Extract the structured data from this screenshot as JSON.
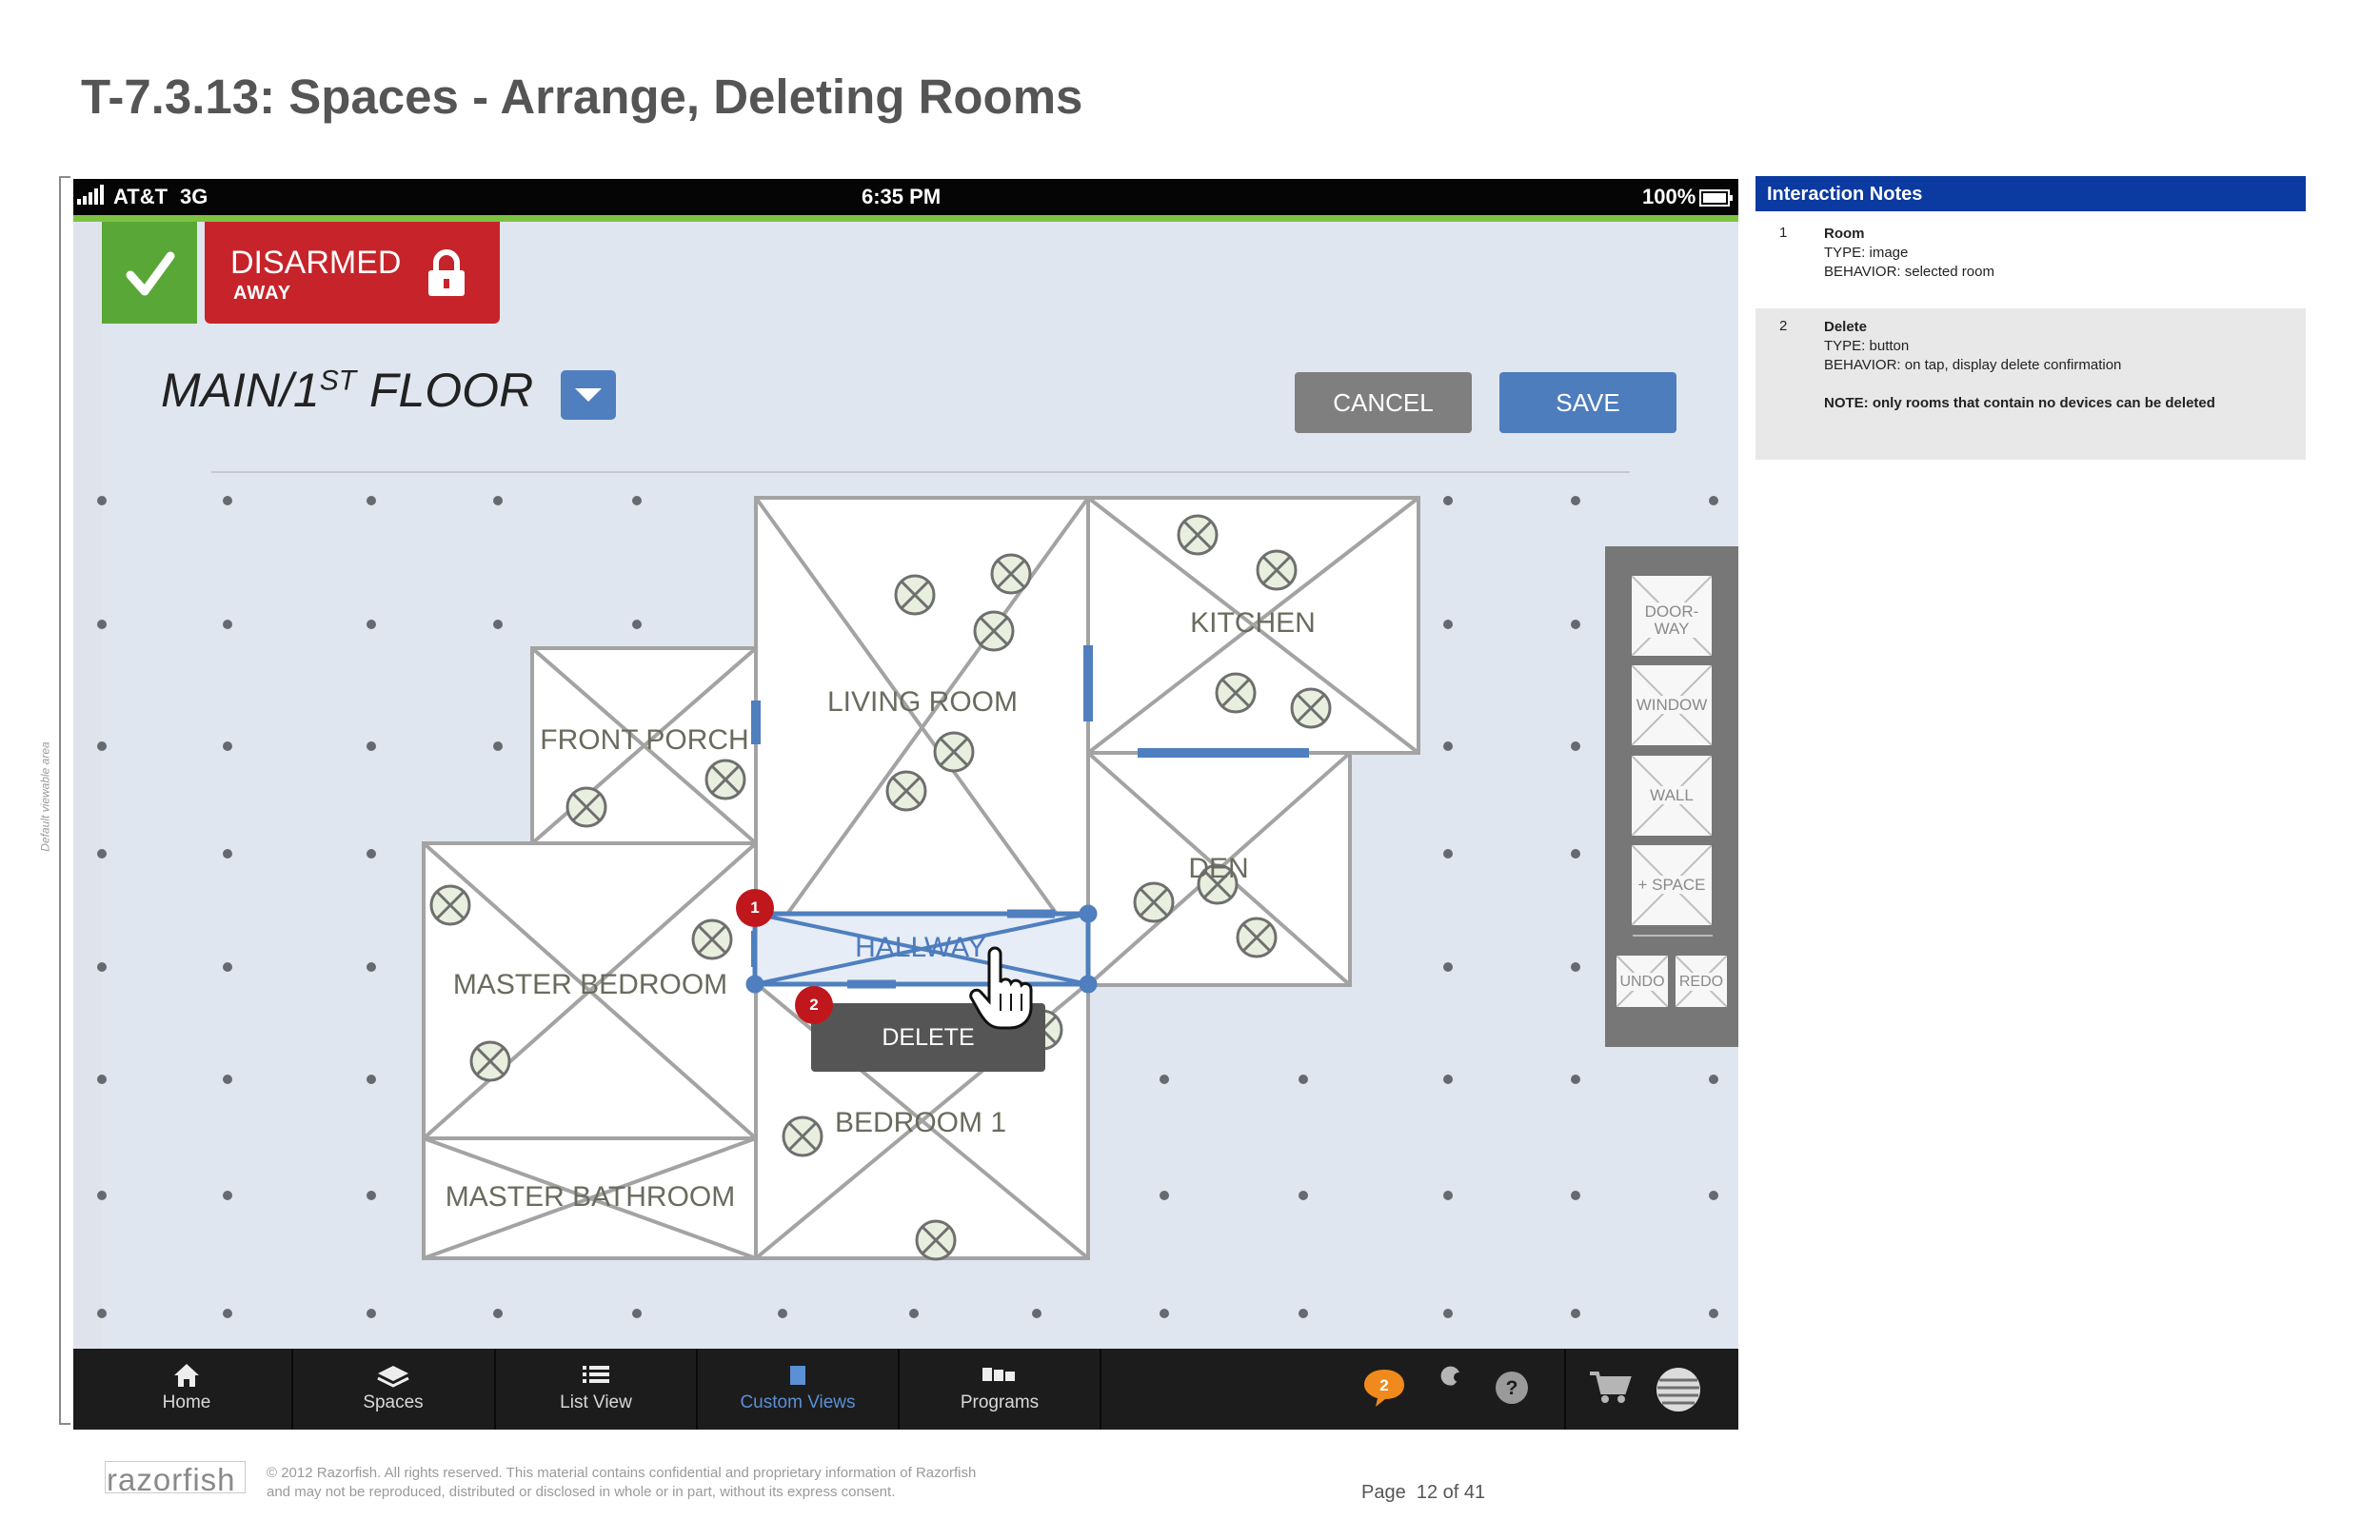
{
  "doc": {
    "title": "T-7.3.13: Spaces - Arrange, Deleting Rooms",
    "viewable_area_label": "Default viewable area",
    "copyright_line1": "© 2012 Razorfish. All rights reserved. This material contains confidential and proprietary information of Razorfish",
    "copyright_line2": "and may not be reproduced, distributed or disclosed in whole or in part, without its express consent.",
    "logo": "razorfish",
    "page_label": "Page",
    "page_number": "12 of 41"
  },
  "status_bar": {
    "carrier": "AT&T",
    "network": "3G",
    "time": "6:35 PM",
    "battery": "100%"
  },
  "security": {
    "state": "DISARMED",
    "mode": "AWAY"
  },
  "floor": {
    "name_prefix": "MAIN/1",
    "superscript": "ST",
    "name_suffix": " FLOOR"
  },
  "actions": {
    "cancel": "CANCEL",
    "save": "SAVE",
    "delete": "DELETE"
  },
  "rooms": {
    "kitchen": "KITCHEN",
    "living_room": "LIVING ROOM",
    "front_porch": "FRONT PORCH",
    "den": "DEN",
    "hallway": "HALLWAY",
    "master_bedroom": "MASTER BEDROOM",
    "bedroom_1": "BEDROOM 1",
    "master_bathroom": "MASTER BATHROOM"
  },
  "toolbox": {
    "doorway_line1": "DOOR-",
    "doorway_line2": "WAY",
    "window": "WINDOW",
    "wall": "WALL",
    "space": "+ SPACE",
    "undo": "UNDO",
    "redo": "REDO"
  },
  "callouts": {
    "room": "1",
    "delete": "2"
  },
  "tab_bar": {
    "tabs": [
      {
        "label": "Home",
        "icon": "home-icon"
      },
      {
        "label": "Spaces",
        "icon": "layers-icon"
      },
      {
        "label": "List View",
        "icon": "list-icon"
      },
      {
        "label": "Custom Views",
        "icon": "custom-views-icon"
      },
      {
        "label": "Programs",
        "icon": "programs-icon"
      }
    ],
    "active_tab": "Custom Views",
    "message_count": "2",
    "icons": [
      "chat-icon",
      "wrench-icon",
      "help-icon",
      "cart-icon",
      "att-globe-icon"
    ]
  },
  "interaction_notes": {
    "header": "Interaction Notes",
    "items": [
      {
        "num": "1",
        "name": "Room",
        "type": "TYPE: image",
        "behavior": "BEHAVIOR: selected room",
        "note": ""
      },
      {
        "num": "2",
        "name": "Delete",
        "type": "TYPE: button",
        "behavior": "BEHAVIOR: on tap, display delete confirmation",
        "note": "NOTE: only rooms that contain no devices can be deleted"
      }
    ]
  },
  "colors": {
    "disarmed_red": "#c6242a",
    "check_green": "#58a737",
    "accent_blue": "#4e7dbd",
    "notes_header_blue": "#0b3aa0",
    "callout_red": "#c0171d"
  }
}
